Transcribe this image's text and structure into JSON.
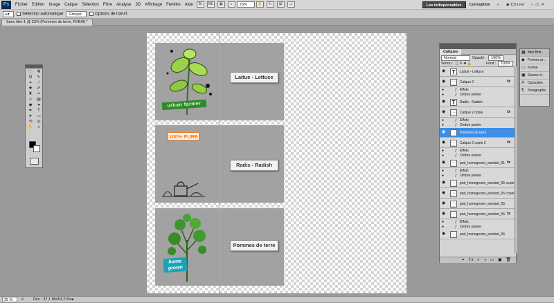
{
  "app": {
    "logo": "Ps"
  },
  "menu": [
    "Fichier",
    "Edition",
    "Image",
    "Calque",
    "Sélection",
    "Filtre",
    "Analyse",
    "3D",
    "Affichage",
    "Fenêtre",
    "Aide"
  ],
  "menubar_icons": {
    "zoom": "25%"
  },
  "workspaces": {
    "active": "Les indispensables",
    "other": "Conception",
    "cslive": "CS Live"
  },
  "options": {
    "auto_select": "Sélection automatique",
    "group": "Groupe",
    "transform": "Options de transf."
  },
  "document": {
    "tab": "Sans titre-1 @ 25% (Pommes de terre, RVB/8) *"
  },
  "status": {
    "zoom": "25 %",
    "doc": "Doc : 37,1 Mo/53,2 Mo"
  },
  "cards": [
    {
      "label": "Laitue - Lettuce",
      "badge": "urban farmer"
    },
    {
      "label": "Radis - Radish",
      "badge": "100% PURE"
    },
    {
      "label": "Pommes de terre",
      "badge": "home grown"
    }
  ],
  "layers_panel": {
    "tab": "Calques",
    "blend": "Normal",
    "opacity_label": "Opacité :",
    "opacity": "100%",
    "lock_label": "Verrou :",
    "fill_label": "Fond :",
    "fill": "100%",
    "rows": [
      {
        "type": "text",
        "name": "Laitue - Lettuce"
      },
      {
        "type": "pixel",
        "name": "Calque 2",
        "fx": "fx"
      },
      {
        "type": "effect",
        "name": "Effets"
      },
      {
        "type": "effect",
        "name": "Ombre portée"
      },
      {
        "type": "text",
        "name": "Radis - Radish"
      },
      {
        "type": "pixel",
        "name": "Calque 2 copie",
        "fx": "fx"
      },
      {
        "type": "effect",
        "name": "Effets"
      },
      {
        "type": "effect",
        "name": "Ombre portée"
      },
      {
        "type": "text",
        "name": "Pommes de terre",
        "selected": true
      },
      {
        "type": "pixel",
        "name": "Calque 2 copie 2",
        "fx": "fx"
      },
      {
        "type": "effect",
        "name": "Effets"
      },
      {
        "type": "effect",
        "name": "Ombre portée"
      },
      {
        "type": "pixel",
        "name": "pnd_homegrown_wordart_01",
        "fx": "fx"
      },
      {
        "type": "effect",
        "name": "Effets"
      },
      {
        "type": "effect",
        "name": "Ombre portée"
      },
      {
        "type": "pixel",
        "name": "pnd_homegrown_wordart_05 copie 2"
      },
      {
        "type": "pixel",
        "name": "pnd_homegrown_wordart_05 copie"
      },
      {
        "type": "pixel",
        "name": "pnd_homegrown_wordart_05"
      },
      {
        "type": "pixel",
        "name": "pnd_homegrown_wordart_06",
        "fx": "fx"
      },
      {
        "type": "effect",
        "name": "Effets"
      },
      {
        "type": "effect",
        "name": "Ombre portée"
      },
      {
        "type": "pixel",
        "name": "pnd_homegrown_wordart_06"
      }
    ]
  },
  "mini_panel": {
    "title": "Mini Brid...",
    "items": [
      "Formes pr...",
      "Forme",
      "Source d...",
      "Caractère",
      "Paragraphe"
    ]
  },
  "colors": {
    "selected": "#3d8ee6",
    "guide": "#60c5f0",
    "badge_green": "#2d8a2d",
    "badge_teal": "#1aa3b4",
    "pure_orange": "#f07a20"
  }
}
